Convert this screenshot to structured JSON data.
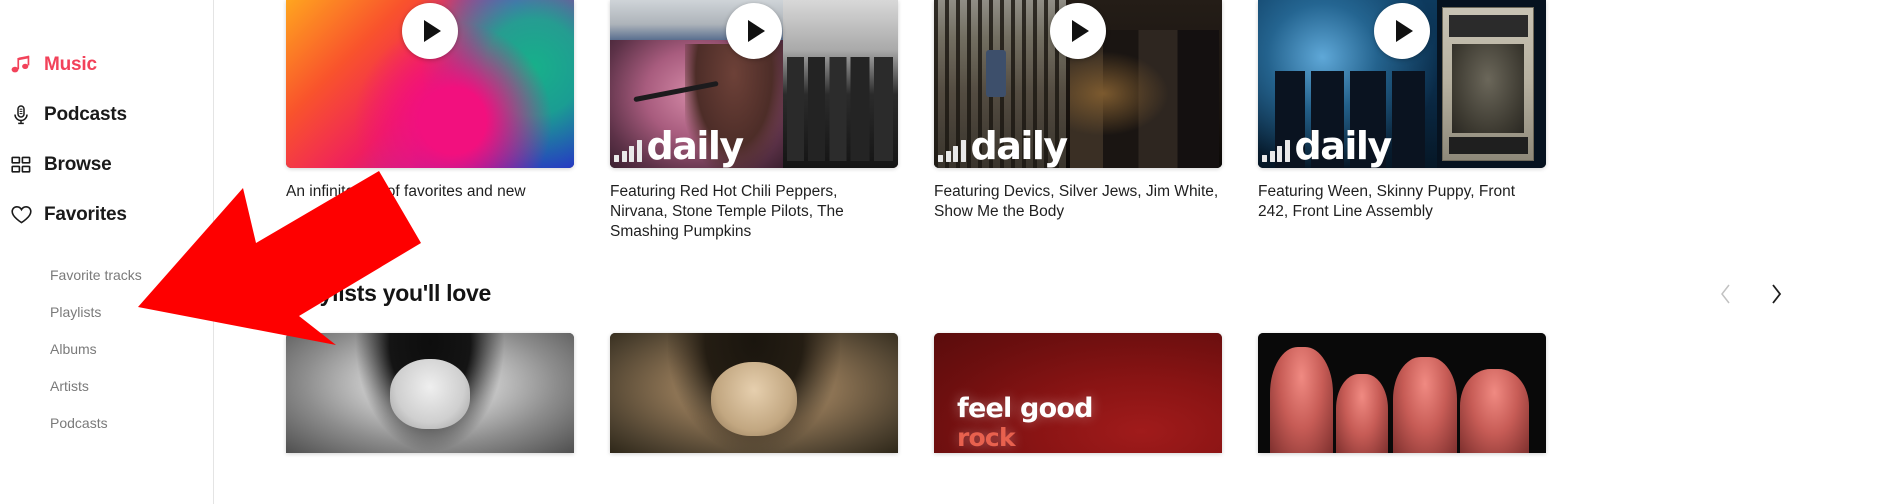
{
  "sidebar": {
    "main_items": [
      {
        "label": "Music",
        "icon": "music-note-icon",
        "active": true
      },
      {
        "label": "Podcasts",
        "icon": "microphone-icon",
        "active": false
      },
      {
        "label": "Browse",
        "icon": "grid-icon",
        "active": false
      },
      {
        "label": "Favorites",
        "icon": "heart-icon",
        "active": false
      }
    ],
    "sub_items": [
      {
        "label": "Favorite tracks"
      },
      {
        "label": "Playlists"
      },
      {
        "label": "Albums"
      },
      {
        "label": "Artists"
      },
      {
        "label": "Podcasts"
      }
    ],
    "active_color": "#f2425a"
  },
  "main": {
    "mixes_row": [
      {
        "caption": "An infinite mix of favorites and new",
        "art": "gradient",
        "play_label": "play-icon",
        "has_daily_logo": false
      },
      {
        "caption": "Featuring Red Hot Chili Peppers, Nirvana, Stone Temple Pilots, The Smashing Pumpkins",
        "art": "singer-photo",
        "play_label": "play-icon",
        "has_daily_logo": true,
        "daily_word": "daily"
      },
      {
        "caption": "Featuring Devics, Silver Jews, Jim White, Show Me the Body",
        "art": "forest-photo",
        "play_label": "play-icon",
        "has_daily_logo": true,
        "daily_word": "daily"
      },
      {
        "caption": "Featuring Ween, Skinny Puppy, Front 242, Front Line Assembly",
        "art": "smoke-poster-photo",
        "play_label": "play-icon",
        "has_daily_logo": true,
        "daily_word": "daily"
      }
    ],
    "playlists_section": {
      "title": "Playlists you'll love",
      "prev_icon": "chevron-left-icon",
      "next_icon": "chevron-right-icon",
      "prev_enabled": false,
      "next_enabled": true,
      "cards": [
        {
          "art": "portrait-bw"
        },
        {
          "art": "portrait-sepia"
        },
        {
          "art": "feel-good-rock",
          "overlay_title": "feel good",
          "overlay_subtitle": "rock"
        },
        {
          "art": "band-red"
        }
      ]
    }
  },
  "annotation": {
    "arrow_color": "#fe0000",
    "arrow_target": "Playlists"
  }
}
